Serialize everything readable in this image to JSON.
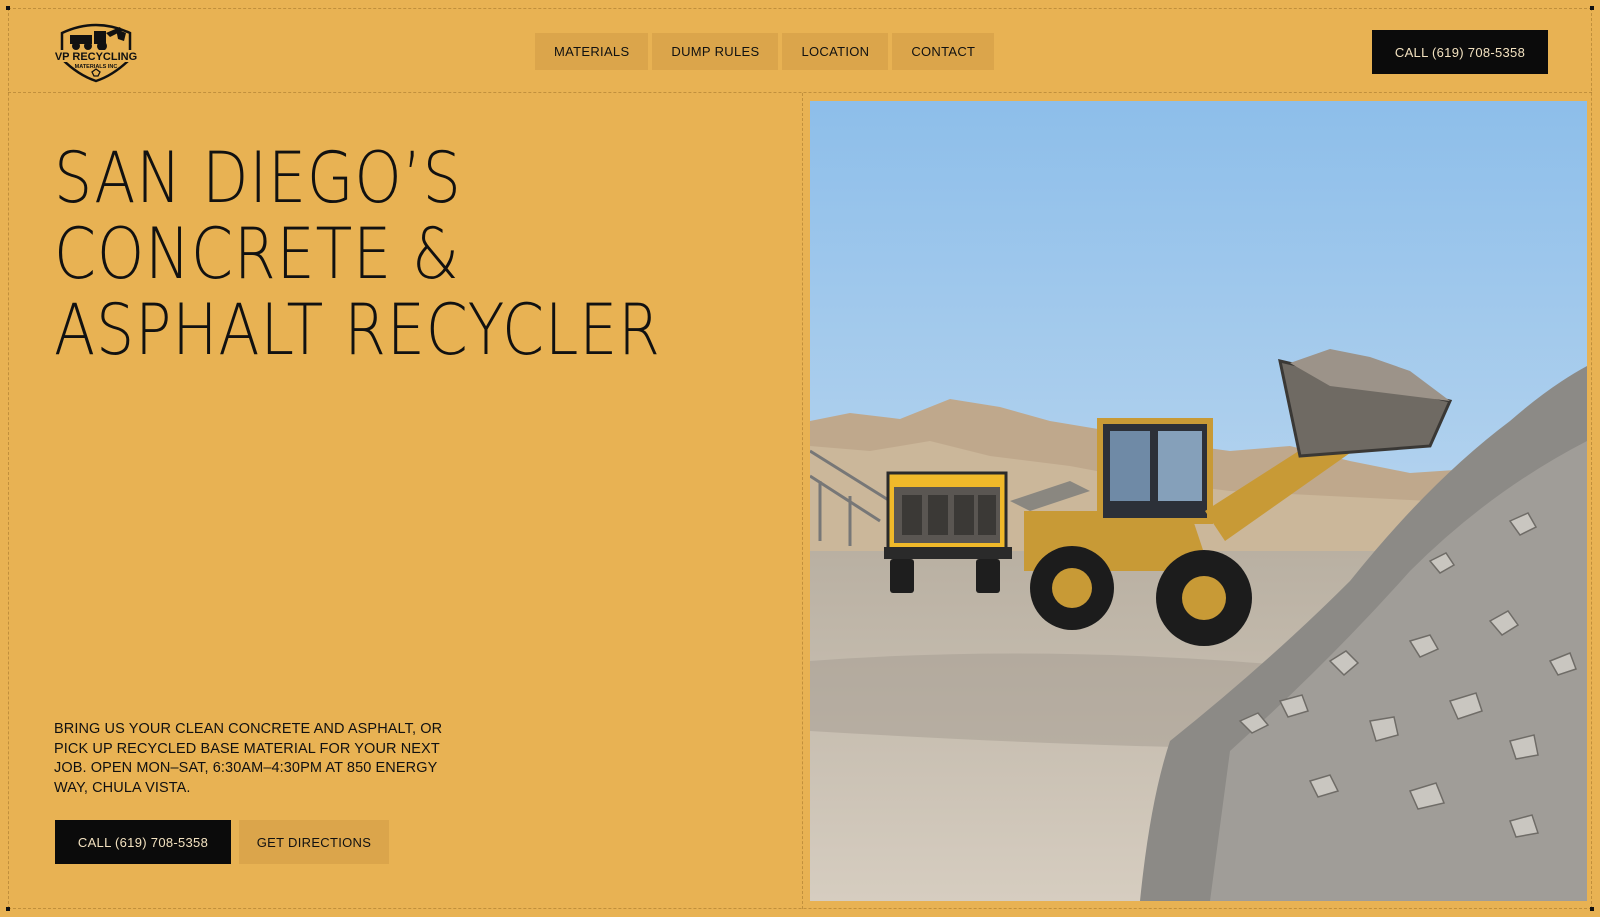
{
  "brand": {
    "logo_line1": "VP RECYCLING",
    "logo_line2": "MATERIALS INC"
  },
  "nav": {
    "items": [
      {
        "label": "MATERIALS"
      },
      {
        "label": "DUMP RULES"
      },
      {
        "label": "LOCATION"
      },
      {
        "label": "CONTACT"
      }
    ]
  },
  "header": {
    "cta_label": "CALL (619) 708-5358"
  },
  "hero": {
    "title_lines": [
      "SAN DIEGO’S",
      "CONCRETE &",
      "ASPHALT RECYCLER"
    ],
    "description": "BRING US YOUR CLEAN CONCRETE AND ASPHALT, OR PICK UP RECYCLED BASE MATERIAL FOR YOUR NEXT JOB. OPEN MON–SAT, 6:30AM–4:30PM AT 850 ENERGY WAY, CHULA VISTA.",
    "call_label": "CALL (619) 708-5358",
    "directions_label": "GET DIRECTIONS"
  },
  "theme": {
    "background": "#e8b253",
    "button_dark": "#0b0b0b",
    "button_light": "#dba54b"
  },
  "icons": {
    "logo": "recycling-truck-logo-icon"
  }
}
